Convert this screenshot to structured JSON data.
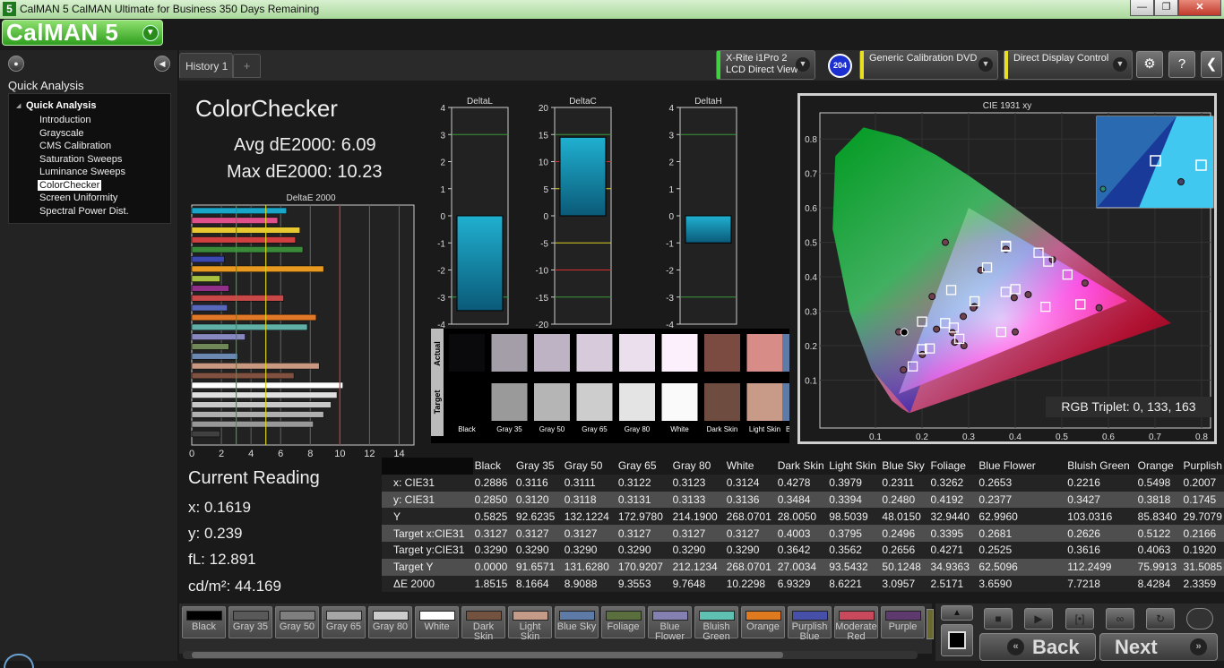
{
  "window": {
    "app_icon": "5",
    "title": "CalMAN 5 CalMAN Ultimate for Business 350 Days Remaining",
    "minimize": "—",
    "maximize": "❐",
    "close": "✕"
  },
  "logo": {
    "text": "CalMAN 5"
  },
  "sidebar": {
    "section_title": "Quick Analysis",
    "tree_root": "Quick Analysis",
    "items": [
      {
        "label": "Introduction",
        "selected": false
      },
      {
        "label": "Grayscale",
        "selected": false
      },
      {
        "label": "CMS Calibration",
        "selected": false
      },
      {
        "label": "Saturation Sweeps",
        "selected": false
      },
      {
        "label": "Luminance Sweeps",
        "selected": false
      },
      {
        "label": "ColorChecker",
        "selected": true
      },
      {
        "label": "Screen Uniformity",
        "selected": false
      },
      {
        "label": "Spectral Power Dist.",
        "selected": false
      }
    ]
  },
  "tabs": {
    "history": "History 1",
    "add": "+"
  },
  "devices": [
    {
      "line1": "X-Rite i1Pro 2",
      "line2": "LCD Direct View",
      "color": "#3fd23f"
    },
    {
      "line1": "Generic Calibration DVD",
      "line2": "",
      "color": "#e8e020"
    },
    {
      "line1": "Direct Display Control",
      "line2": "",
      "color": "#e8e020"
    }
  ],
  "device_badge": "204",
  "toolbar": {
    "settings": "⚙",
    "help": "?",
    "collapse": "❮"
  },
  "main": {
    "title": "ColorChecker",
    "avg_de": "Avg dE2000: 6.09",
    "max_de": "Max dE2000: 10.23"
  },
  "current_reading": {
    "title": "Current Reading",
    "x": "x: 0.1619",
    "y": "y: 0.239",
    "fl": "fL: 12.891",
    "cdm2": "cd/m²: 44.169"
  },
  "deltae_chart": {
    "title": "DeltaE 2000",
    "xlim": [
      0,
      15
    ],
    "ticks": [
      "0",
      "2",
      "4",
      "6",
      "8",
      "10",
      "12",
      "14"
    ],
    "thresholds": [
      {
        "value": 3,
        "color": "#3a9a3a"
      },
      {
        "value": 5,
        "color": "#d8d020"
      },
      {
        "value": 10,
        "color": "#d83030"
      }
    ],
    "bars": [
      {
        "value": 6.4,
        "color": "#1aa6c8"
      },
      {
        "value": 5.8,
        "color": "#e0508a"
      },
      {
        "value": 7.3,
        "color": "#e8c830"
      },
      {
        "value": 7.0,
        "color": "#d04040"
      },
      {
        "value": 7.5,
        "color": "#3a8a3a"
      },
      {
        "value": 2.2,
        "color": "#3a48b0"
      },
      {
        "value": 8.9,
        "color": "#e89a20"
      },
      {
        "value": 1.9,
        "color": "#a8c040"
      },
      {
        "value": 2.5,
        "color": "#903088"
      },
      {
        "value": 6.2,
        "color": "#c84848"
      },
      {
        "value": 2.4,
        "color": "#5868b8"
      },
      {
        "value": 8.4,
        "color": "#e07828"
      },
      {
        "value": 7.8,
        "color": "#60b0a8"
      },
      {
        "value": 3.6,
        "color": "#8888c0"
      },
      {
        "value": 2.5,
        "color": "#708858"
      },
      {
        "value": 3.1,
        "color": "#6a88b0"
      },
      {
        "value": 8.6,
        "color": "#c89880"
      },
      {
        "value": 6.9,
        "color": "#805040"
      },
      {
        "value": 10.2,
        "color": "#ffffff"
      },
      {
        "value": 9.8,
        "color": "#e0e0e0"
      },
      {
        "value": 9.4,
        "color": "#c8c8c8"
      },
      {
        "value": 8.9,
        "color": "#b0b0b0"
      },
      {
        "value": 8.2,
        "color": "#989898"
      },
      {
        "value": 1.9,
        "color": "#404040"
      }
    ]
  },
  "delta_charts": [
    {
      "title": "DeltaL",
      "ylim": [
        -4,
        4
      ],
      "ticks": [
        "4",
        "3",
        "2",
        "1",
        "0",
        "-1",
        "-2",
        "-3",
        "-4"
      ],
      "value": -3.5,
      "green": 3,
      "yellow": null,
      "red": null
    },
    {
      "title": "DeltaC",
      "ylim": [
        -20,
        20
      ],
      "ticks": [
        "20",
        "15",
        "10",
        "5",
        "0",
        "-5",
        "-10",
        "-15",
        "-20"
      ],
      "value": 14.5,
      "green": 15,
      "yellow": 5,
      "red": 10
    },
    {
      "title": "DeltaH",
      "ylim": [
        -4,
        4
      ],
      "ticks": [
        "4",
        "3",
        "2",
        "1",
        "0",
        "-1",
        "-2",
        "-3",
        "-4"
      ],
      "value": -1.0,
      "green": 3,
      "yellow": null,
      "red": null
    }
  ],
  "patch_compare": {
    "actual_label": "Actual",
    "target_label": "Target",
    "patches": [
      {
        "name": "Black",
        "actual": "#0a0a0d",
        "target": "#000000"
      },
      {
        "name": "Gray 35",
        "actual": "#a49ea8",
        "target": "#9a9a9a"
      },
      {
        "name": "Gray 50",
        "actual": "#bdb3c4",
        "target": "#b5b5b5"
      },
      {
        "name": "Gray 65",
        "actual": "#d6cadb",
        "target": "#cdcdcd"
      },
      {
        "name": "Gray 80",
        "actual": "#ebdfee",
        "target": "#e4e4e4"
      },
      {
        "name": "White",
        "actual": "#fcf0fc",
        "target": "#fafafa"
      },
      {
        "name": "Dark Skin",
        "actual": "#7b4b42",
        "target": "#6e4c40"
      },
      {
        "name": "Light Skin",
        "actual": "#d88c88",
        "target": "#c89a88"
      }
    ]
  },
  "cie_chart": {
    "title": "CIE 1931 xy",
    "xlim": [
      0,
      0.8
    ],
    "ylim": [
      0,
      0.85
    ],
    "xticks": [
      "0.1",
      "0.2",
      "0.3",
      "0.4",
      "0.5",
      "0.6",
      "0.7",
      "0.8"
    ],
    "yticks": [
      "0.1",
      "0.2",
      "0.3",
      "0.4",
      "0.5",
      "0.6",
      "0.7",
      "0.8"
    ],
    "gamut": [
      [
        0.64,
        0.33
      ],
      [
        0.3,
        0.6
      ],
      [
        0.15,
        0.06
      ]
    ],
    "targets": [
      [
        0.3127,
        0.329
      ],
      [
        0.4003,
        0.3642
      ],
      [
        0.3795,
        0.3562
      ],
      [
        0.2496,
        0.2656
      ],
      [
        0.3395,
        0.4271
      ],
      [
        0.2681,
        0.2525
      ],
      [
        0.2626,
        0.3616
      ],
      [
        0.5122,
        0.4063
      ],
      [
        0.2166,
        0.192
      ],
      [
        0.4649,
        0.3129
      ],
      [
        0.3803,
        0.4876
      ],
      [
        0.4708,
        0.4441
      ],
      [
        0.18,
        0.14
      ],
      [
        0.2,
        0.27
      ],
      [
        0.54,
        0.32
      ],
      [
        0.45,
        0.47
      ],
      [
        0.37,
        0.24
      ],
      [
        0.2,
        0.19
      ],
      [
        0.28,
        0.22
      ],
      [
        0.38,
        0.49
      ]
    ],
    "actuals": [
      [
        0.2886,
        0.285
      ],
      [
        0.3124,
        0.3136
      ],
      [
        0.4278,
        0.3484
      ],
      [
        0.3979,
        0.3394
      ],
      [
        0.2311,
        0.248
      ],
      [
        0.3262,
        0.4192
      ],
      [
        0.2653,
        0.2377
      ],
      [
        0.2216,
        0.3427
      ],
      [
        0.5498,
        0.3818
      ],
      [
        0.2007,
        0.1745
      ],
      [
        0.38,
        0.48
      ],
      [
        0.48,
        0.45
      ],
      [
        0.16,
        0.13
      ],
      [
        0.15,
        0.24
      ],
      [
        0.58,
        0.31
      ],
      [
        0.27,
        0.21
      ],
      [
        0.4,
        0.24
      ],
      [
        0.25,
        0.5
      ],
      [
        0.29,
        0.2
      ],
      [
        0.31,
        0.31
      ]
    ],
    "measured": {
      "x": 0.1619,
      "y": 0.239
    },
    "rgb_triplet": "RGB Triplet: 0, 133, 163"
  },
  "data_table": {
    "columns": [
      "Black",
      "Gray 35",
      "Gray 50",
      "Gray 65",
      "Gray 80",
      "White",
      "Dark Skin",
      "Light Skin",
      "Blue Sky",
      "Foliage",
      "Blue Flower",
      "Bluish Green",
      "Orange",
      "Purplish"
    ],
    "rows": [
      {
        "label": "x: CIE31",
        "values": [
          "0.2886",
          "0.3116",
          "0.3111",
          "0.3122",
          "0.3123",
          "0.3124",
          "0.4278",
          "0.3979",
          "0.2311",
          "0.3262",
          "0.2653",
          "0.2216",
          "0.5498",
          "0.2007"
        ]
      },
      {
        "label": "y: CIE31",
        "values": [
          "0.2850",
          "0.3120",
          "0.3118",
          "0.3131",
          "0.3133",
          "0.3136",
          "0.3484",
          "0.3394",
          "0.2480",
          "0.4192",
          "0.2377",
          "0.3427",
          "0.3818",
          "0.1745"
        ]
      },
      {
        "label": "Y",
        "values": [
          "0.5825",
          "92.6235",
          "132.1224",
          "172.9780",
          "214.1900",
          "268.0701",
          "28.0050",
          "98.5039",
          "48.0150",
          "32.9440",
          "62.9960",
          "103.0316",
          "85.8340",
          "29.7079"
        ]
      },
      {
        "label": "Target x:CIE31",
        "values": [
          "0.3127",
          "0.3127",
          "0.3127",
          "0.3127",
          "0.3127",
          "0.3127",
          "0.4003",
          "0.3795",
          "0.2496",
          "0.3395",
          "0.2681",
          "0.2626",
          "0.5122",
          "0.2166"
        ]
      },
      {
        "label": "Target y:CIE31",
        "values": [
          "0.3290",
          "0.3290",
          "0.3290",
          "0.3290",
          "0.3290",
          "0.3290",
          "0.3642",
          "0.3562",
          "0.2656",
          "0.4271",
          "0.2525",
          "0.3616",
          "0.4063",
          "0.1920"
        ]
      },
      {
        "label": "Target Y",
        "values": [
          "0.0000",
          "91.6571",
          "131.6280",
          "170.9207",
          "212.1234",
          "268.0701",
          "27.0034",
          "93.5432",
          "50.1248",
          "34.9363",
          "62.5096",
          "112.2499",
          "75.9913",
          "31.5085"
        ]
      },
      {
        "label": "ΔE 2000",
        "values": [
          "1.8515",
          "8.1664",
          "8.9088",
          "9.3553",
          "9.7648",
          "10.2298",
          "6.9329",
          "8.6221",
          "3.0957",
          "2.5171",
          "3.6590",
          "7.7218",
          "8.4284",
          "2.3359"
        ]
      }
    ]
  },
  "swatches": [
    {
      "label": "Black",
      "color": "#000000"
    },
    {
      "label": "Gray 35",
      "color": "#595959"
    },
    {
      "label": "Gray 50",
      "color": "#7f7f7f"
    },
    {
      "label": "Gray 65",
      "color": "#a6a6a6"
    },
    {
      "label": "Gray 80",
      "color": "#cccccc"
    },
    {
      "label": "White",
      "color": "#ffffff"
    },
    {
      "label": "Dark Skin",
      "color": "#73523f"
    },
    {
      "label": "Light Skin",
      "color": "#c49a88"
    },
    {
      "label": "Blue Sky",
      "color": "#5d7ba6"
    },
    {
      "label": "Foliage",
      "color": "#5b6e3e"
    },
    {
      "label": "Blue Flower",
      "color": "#8580b2"
    },
    {
      "label": "Bluish Green",
      "color": "#5fc1b1"
    },
    {
      "label": "Orange",
      "color": "#e07a1f"
    },
    {
      "label": "Purplish Blue",
      "color": "#4650a8"
    },
    {
      "label": "Moderate Red",
      "color": "#c8485c"
    },
    {
      "label": "Purple",
      "color": "#5e3a6e"
    }
  ],
  "navigation": {
    "back": "Back",
    "next": "Next",
    "back_chevron": "«",
    "next_chevron": "»",
    "up": "▲",
    "down": "▼",
    "stop": "■",
    "play": "▶",
    "step": "[•]",
    "loop": "∞",
    "refresh": "↻"
  }
}
